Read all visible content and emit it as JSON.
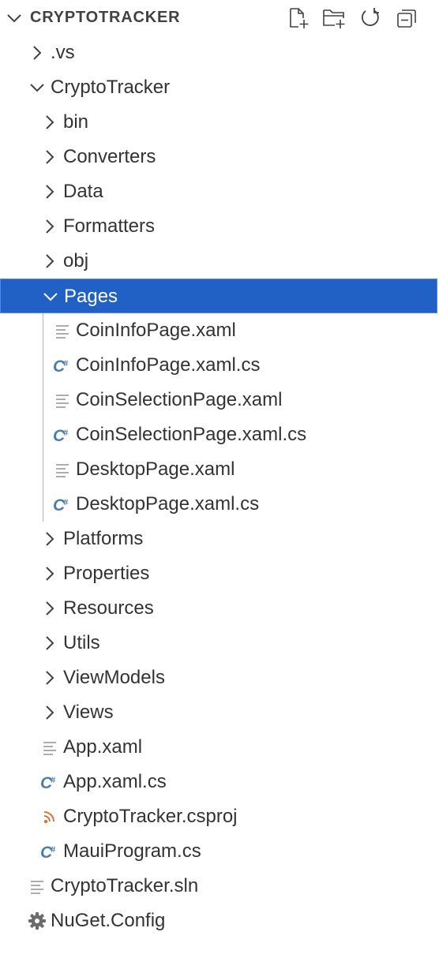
{
  "explorer": {
    "title": "CRYPTOTRACKER",
    "actions": [
      {
        "name": "new-file-icon"
      },
      {
        "name": "new-folder-icon"
      },
      {
        "name": "refresh-icon"
      },
      {
        "name": "collapse-all-icon"
      }
    ]
  },
  "tree": [
    {
      "label": ".vs",
      "type": "folder",
      "expanded": false,
      "depth": 1
    },
    {
      "label": "CryptoTracker",
      "type": "folder",
      "expanded": true,
      "depth": 1
    },
    {
      "label": "bin",
      "type": "folder",
      "expanded": false,
      "depth": 2
    },
    {
      "label": "Converters",
      "type": "folder",
      "expanded": false,
      "depth": 2
    },
    {
      "label": "Data",
      "type": "folder",
      "expanded": false,
      "depth": 2
    },
    {
      "label": "Formatters",
      "type": "folder",
      "expanded": false,
      "depth": 2
    },
    {
      "label": "obj",
      "type": "folder",
      "expanded": false,
      "depth": 2
    },
    {
      "label": "Pages",
      "type": "folder",
      "expanded": true,
      "depth": 2,
      "selected": true
    },
    {
      "label": "CoinInfoPage.xaml",
      "type": "xaml",
      "depth": 3
    },
    {
      "label": "CoinInfoPage.xaml.cs",
      "type": "csharp",
      "depth": 3
    },
    {
      "label": "CoinSelectionPage.xaml",
      "type": "xaml",
      "depth": 3
    },
    {
      "label": "CoinSelectionPage.xaml.cs",
      "type": "csharp",
      "depth": 3
    },
    {
      "label": "DesktopPage.xaml",
      "type": "xaml",
      "depth": 3
    },
    {
      "label": "DesktopPage.xaml.cs",
      "type": "csharp",
      "depth": 3
    },
    {
      "label": "Platforms",
      "type": "folder",
      "expanded": false,
      "depth": 2
    },
    {
      "label": "Properties",
      "type": "folder",
      "expanded": false,
      "depth": 2
    },
    {
      "label": "Resources",
      "type": "folder",
      "expanded": false,
      "depth": 2
    },
    {
      "label": "Utils",
      "type": "folder",
      "expanded": false,
      "depth": 2
    },
    {
      "label": "ViewModels",
      "type": "folder",
      "expanded": false,
      "depth": 2
    },
    {
      "label": "Views",
      "type": "folder",
      "expanded": false,
      "depth": 2
    },
    {
      "label": "App.xaml",
      "type": "xaml",
      "depth": 2
    },
    {
      "label": "App.xaml.cs",
      "type": "csharp",
      "depth": 2
    },
    {
      "label": "CryptoTracker.csproj",
      "type": "rss",
      "depth": 2
    },
    {
      "label": "MauiProgram.cs",
      "type": "csharp",
      "depth": 2
    },
    {
      "label": "CryptoTracker.sln",
      "type": "xaml",
      "depth": 1
    },
    {
      "label": "NuGet.Config",
      "type": "gear",
      "depth": 1
    }
  ],
  "colors": {
    "selection": "#2160c4",
    "csharp_icon": "#4a7ea8",
    "rss_icon": "#d4773a",
    "text": "#333333"
  }
}
